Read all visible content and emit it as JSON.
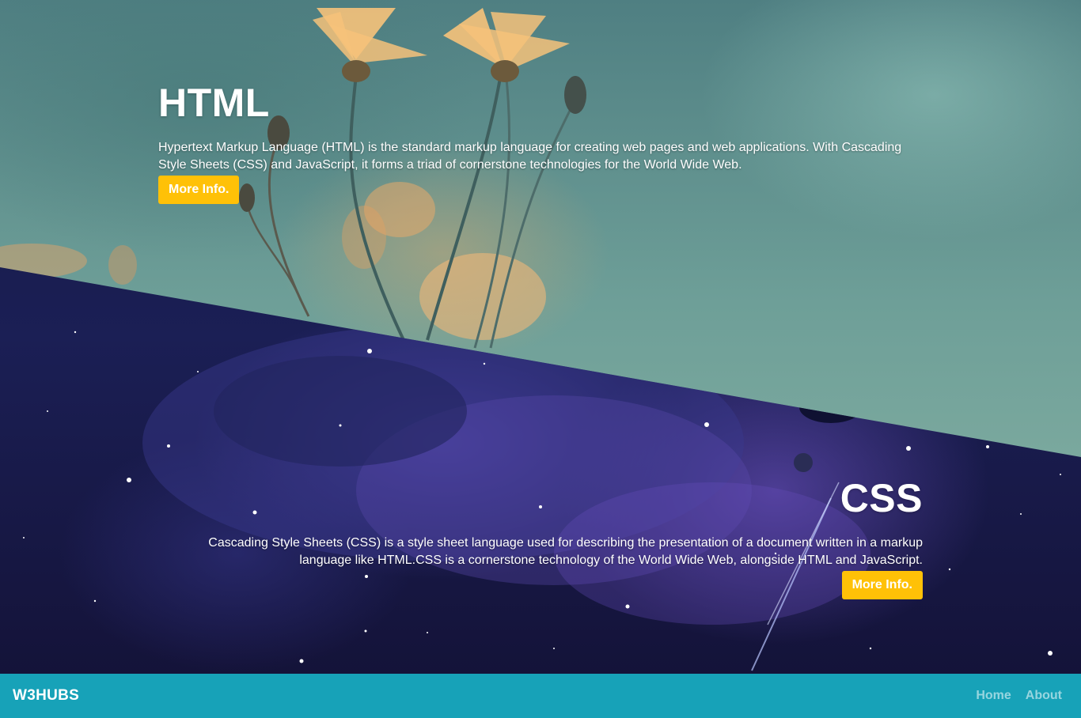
{
  "sections": {
    "html": {
      "heading": "HTML",
      "description": "Hypertext Markup Language (HTML) is the standard markup language for creating web pages and web applications. With Cascading Style Sheets (CSS) and JavaScript, it forms a triad of cornerstone technologies for the World Wide Web.",
      "button_label": "More Info."
    },
    "css": {
      "heading": "CSS",
      "description": "Cascading Style Sheets (CSS) is a style sheet language used for describing the presentation of a document written in a markup language like HTML.CSS is a cornerstone technology of the World Wide Web, alongside HTML and JavaScript.",
      "button_label": "More Info."
    }
  },
  "navbar": {
    "brand": "W3HUBS",
    "links": [
      {
        "label": "Home"
      },
      {
        "label": "About"
      }
    ]
  },
  "colors": {
    "button": "#ffc107",
    "navbar": "#17a2b8"
  }
}
